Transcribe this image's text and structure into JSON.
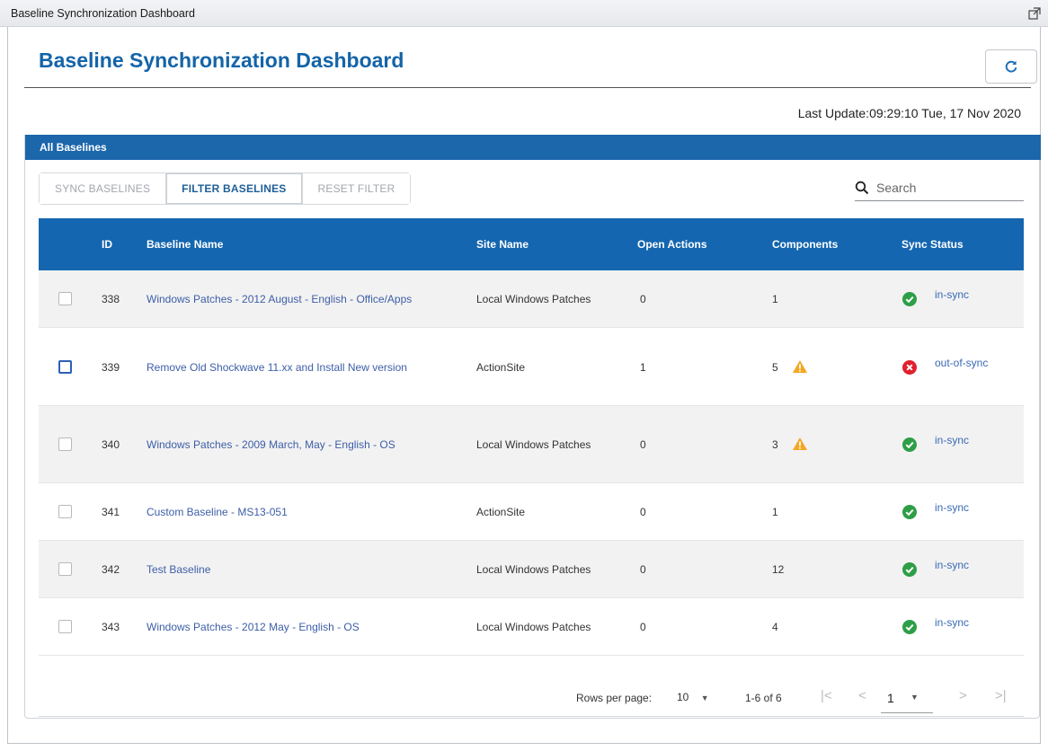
{
  "window": {
    "title": "Baseline Synchronization Dashboard"
  },
  "page": {
    "title": "Baseline Synchronization Dashboard",
    "refresh_icon": "refresh-icon"
  },
  "last_update": {
    "label": "Last Update:",
    "value": "09:29:10 Tue, 17 Nov 2020"
  },
  "card": {
    "header": "All Baselines"
  },
  "toolbar": {
    "sync_label": "SYNC BASELINES",
    "filter_label": "FILTER BASELINES",
    "reset_label": "RESET FILTER"
  },
  "search": {
    "placeholder": "Search"
  },
  "table": {
    "columns": {
      "id": "ID",
      "name": "Baseline Name",
      "site": "Site Name",
      "actions": "Open Actions",
      "components": "Components",
      "status": "Sync Status"
    },
    "rows": [
      {
        "id": "338",
        "name": "Windows Patches - 2012 August - English - Office/Apps",
        "site": "Local Windows Patches",
        "actions": "0",
        "components": "1",
        "warning": false,
        "status": "in-sync",
        "ok": true
      },
      {
        "id": "339",
        "name": "Remove Old Shockwave 11.xx and Install New version",
        "site": "ActionSite",
        "actions": "1",
        "components": "5",
        "warning": true,
        "status": "out-of-sync",
        "ok": false
      },
      {
        "id": "340",
        "name": "Windows Patches - 2009 March, May - English - OS",
        "site": "Local Windows Patches",
        "actions": "0",
        "components": "3",
        "warning": true,
        "status": "in-sync",
        "ok": true
      },
      {
        "id": "341",
        "name": "Custom Baseline - MS13-051",
        "site": "ActionSite",
        "actions": "0",
        "components": "1",
        "warning": false,
        "status": "in-sync",
        "ok": true
      },
      {
        "id": "342",
        "name": "Test Baseline",
        "site": "Local Windows Patches",
        "actions": "0",
        "components": "12",
        "warning": false,
        "status": "in-sync",
        "ok": true
      },
      {
        "id": "343",
        "name": "Windows Patches - 2012 May - English - OS",
        "site": "Local Windows Patches",
        "actions": "0",
        "components": "4",
        "warning": false,
        "status": "in-sync",
        "ok": true
      }
    ]
  },
  "pagination": {
    "rows_per_page_label": "Rows per page:",
    "rows_per_page": "10",
    "range": "1-6 of 6",
    "page": "1"
  },
  "colors": {
    "primary": "#1466b0",
    "title": "#1464a8",
    "link": "#3d5ea8",
    "ok": "#2e9e47",
    "error": "#e0202e",
    "warning": "#f5a623"
  }
}
